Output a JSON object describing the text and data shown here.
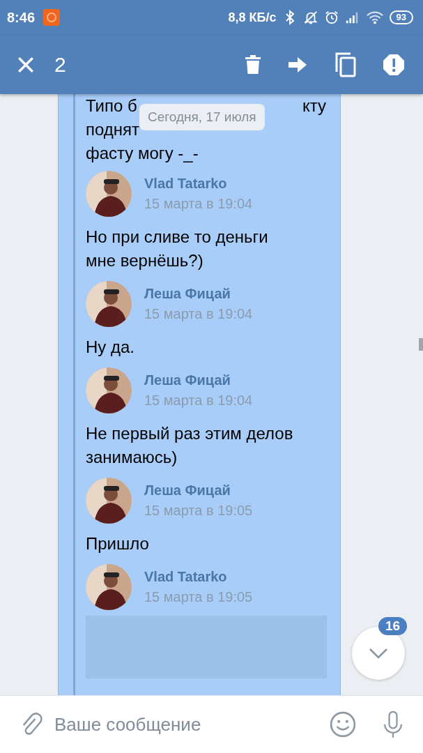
{
  "status_bar": {
    "time": "8:46",
    "speed": "8,8 КБ/с",
    "battery": "93"
  },
  "toolbar": {
    "selected_count": "2"
  },
  "date_pill": "Сегодня, 17 июля",
  "covered_message": {
    "line_1_start": "Типо б",
    "line_1_end": "кту",
    "line_2_start": "поднят",
    "line_3": "фасту могу -_-"
  },
  "items": [
    {
      "kind": "header",
      "name": "Vlad Tatarko",
      "date": "15 марта в 19:04"
    },
    {
      "kind": "text",
      "text": "Но при сливе то деньги мне вернёшь?)"
    },
    {
      "kind": "header",
      "name": "Леша Фицай",
      "date": "15 марта в 19:04"
    },
    {
      "kind": "text",
      "text": "Ну да."
    },
    {
      "kind": "header",
      "name": "Леша Фицай",
      "date": "15 марта в 19:04"
    },
    {
      "kind": "text",
      "text": "Не первый раз этим делов занимаюсь)"
    },
    {
      "kind": "header",
      "name": "Леша Фицай",
      "date": "15 марта в 19:05"
    },
    {
      "kind": "text",
      "text": "Пришло"
    },
    {
      "kind": "header",
      "name": "Vlad Tatarko",
      "date": "15 марта в 19:05"
    },
    {
      "kind": "attachment"
    }
  ],
  "scroll_button": {
    "badge": "16"
  },
  "composer": {
    "placeholder": "Ваше сообщение"
  }
}
